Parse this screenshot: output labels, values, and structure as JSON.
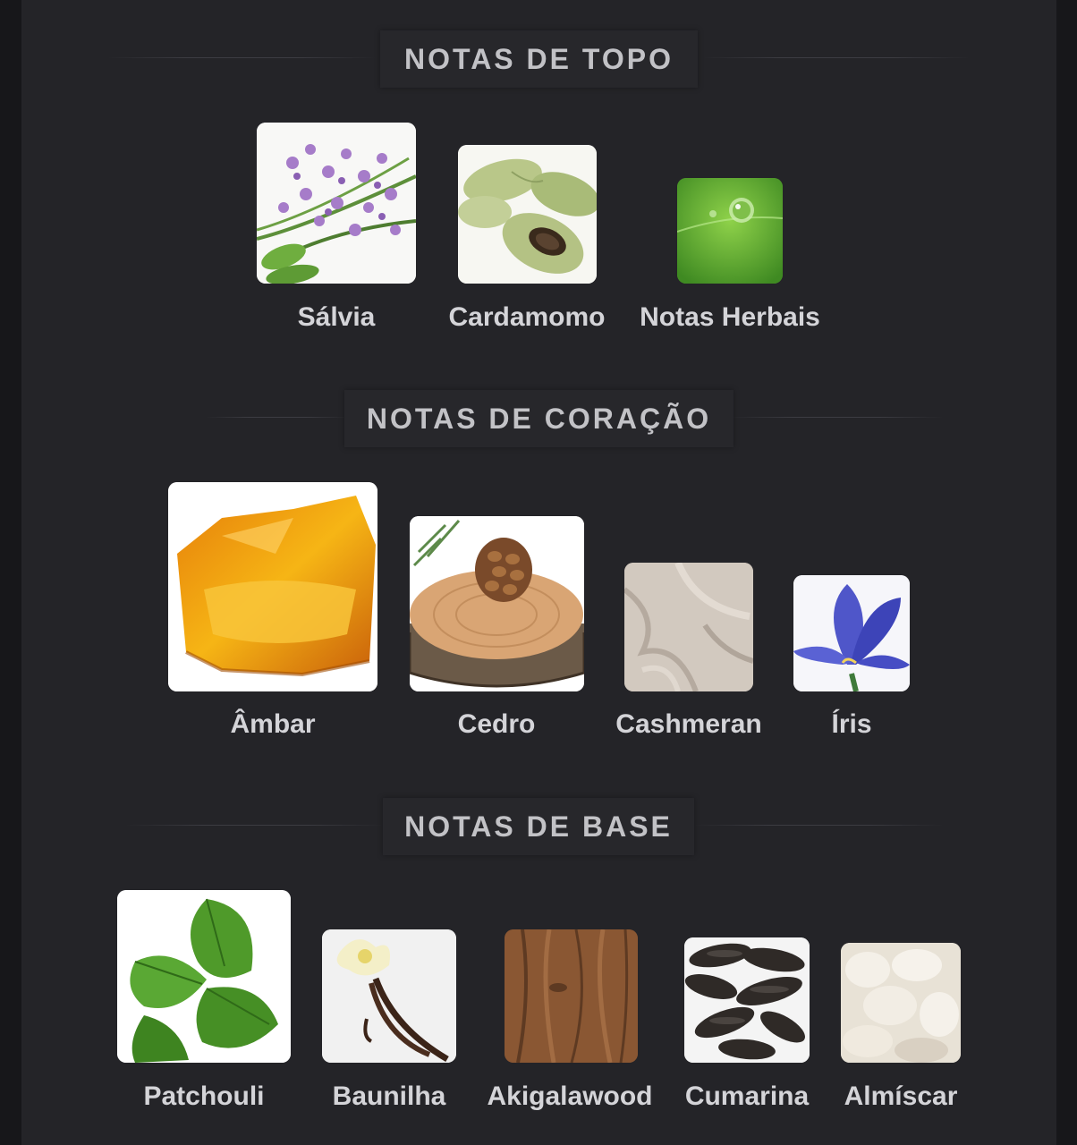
{
  "sections": [
    {
      "title": "NOTAS DE TOPO",
      "notes": [
        {
          "label": "Sálvia",
          "icon": "sage-flower-icon"
        },
        {
          "label": "Cardamomo",
          "icon": "cardamom-pod-icon"
        },
        {
          "label": "Notas Herbais",
          "icon": "green-leaf-droplet-icon"
        }
      ]
    },
    {
      "title": "NOTAS DE CORAÇÃO",
      "notes": [
        {
          "label": "Âmbar",
          "icon": "amber-stone-icon"
        },
        {
          "label": "Cedro",
          "icon": "cedar-wood-icon"
        },
        {
          "label": "Cashmeran",
          "icon": "cashmere-fabric-icon"
        },
        {
          "label": "Íris",
          "icon": "iris-flower-icon"
        }
      ]
    },
    {
      "title": "NOTAS DE BASE",
      "notes": [
        {
          "label": "Patchouli",
          "icon": "patchouli-leaf-icon"
        },
        {
          "label": "Baunilha",
          "icon": "vanilla-pod-icon"
        },
        {
          "label": "Akigalawood",
          "icon": "wood-grain-icon"
        },
        {
          "label": "Cumarina",
          "icon": "tonka-bean-icon"
        },
        {
          "label": "Almíscar",
          "icon": "musk-texture-icon"
        }
      ]
    }
  ]
}
